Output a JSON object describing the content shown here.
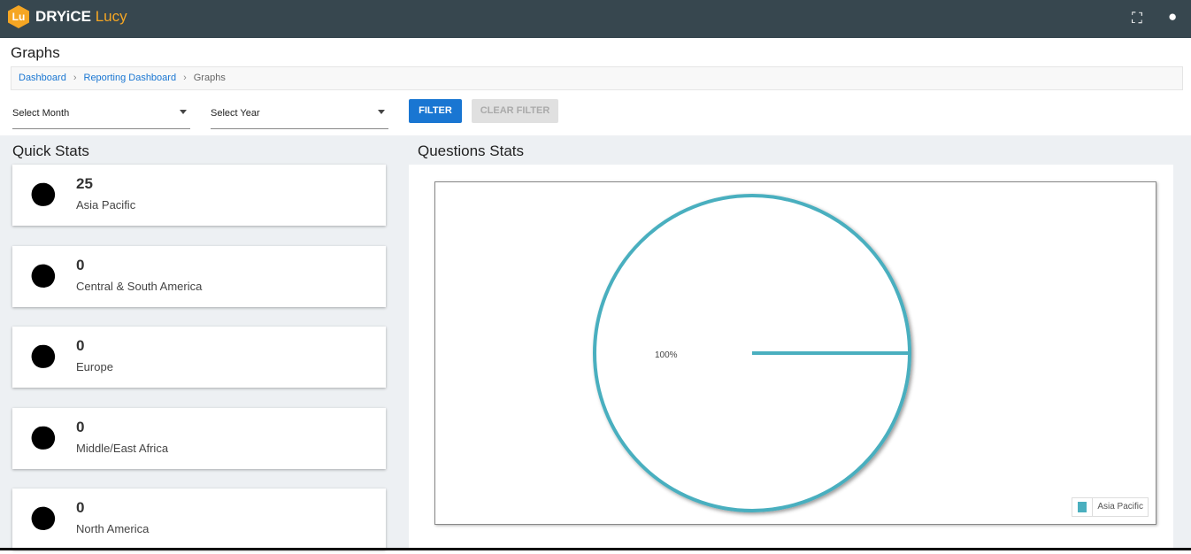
{
  "header": {
    "logo_badge": "Lu",
    "brand": "DRYiCE",
    "product": "Lucy"
  },
  "page": {
    "title": "Graphs"
  },
  "breadcrumb": [
    "Dashboard",
    "Reporting Dashboard",
    "Graphs"
  ],
  "filters": {
    "month": "Select Month",
    "year": "Select Year",
    "filter": "FILTER",
    "clear": "CLEAR FILTER"
  },
  "quick_stats": {
    "title": "Quick Stats",
    "items": [
      {
        "value": "25",
        "label": "Asia Pacific"
      },
      {
        "value": "0",
        "label": "Central & South America"
      },
      {
        "value": "0",
        "label": "Europe"
      },
      {
        "value": "0",
        "label": "Middle/East Africa"
      },
      {
        "value": "0",
        "label": "North America"
      }
    ]
  },
  "questions_stats": {
    "title": "Questions Stats"
  },
  "colors": {
    "header": "#37474f",
    "accent": "#1976d2",
    "slice": "#4aafbf"
  },
  "chart_data": {
    "type": "pie",
    "categories": [
      "Asia Pacific"
    ],
    "values": [
      25
    ],
    "slice_labels": [
      "100%"
    ],
    "legend": [
      "Asia Pacific"
    ],
    "legend_position": "bottom-right"
  }
}
